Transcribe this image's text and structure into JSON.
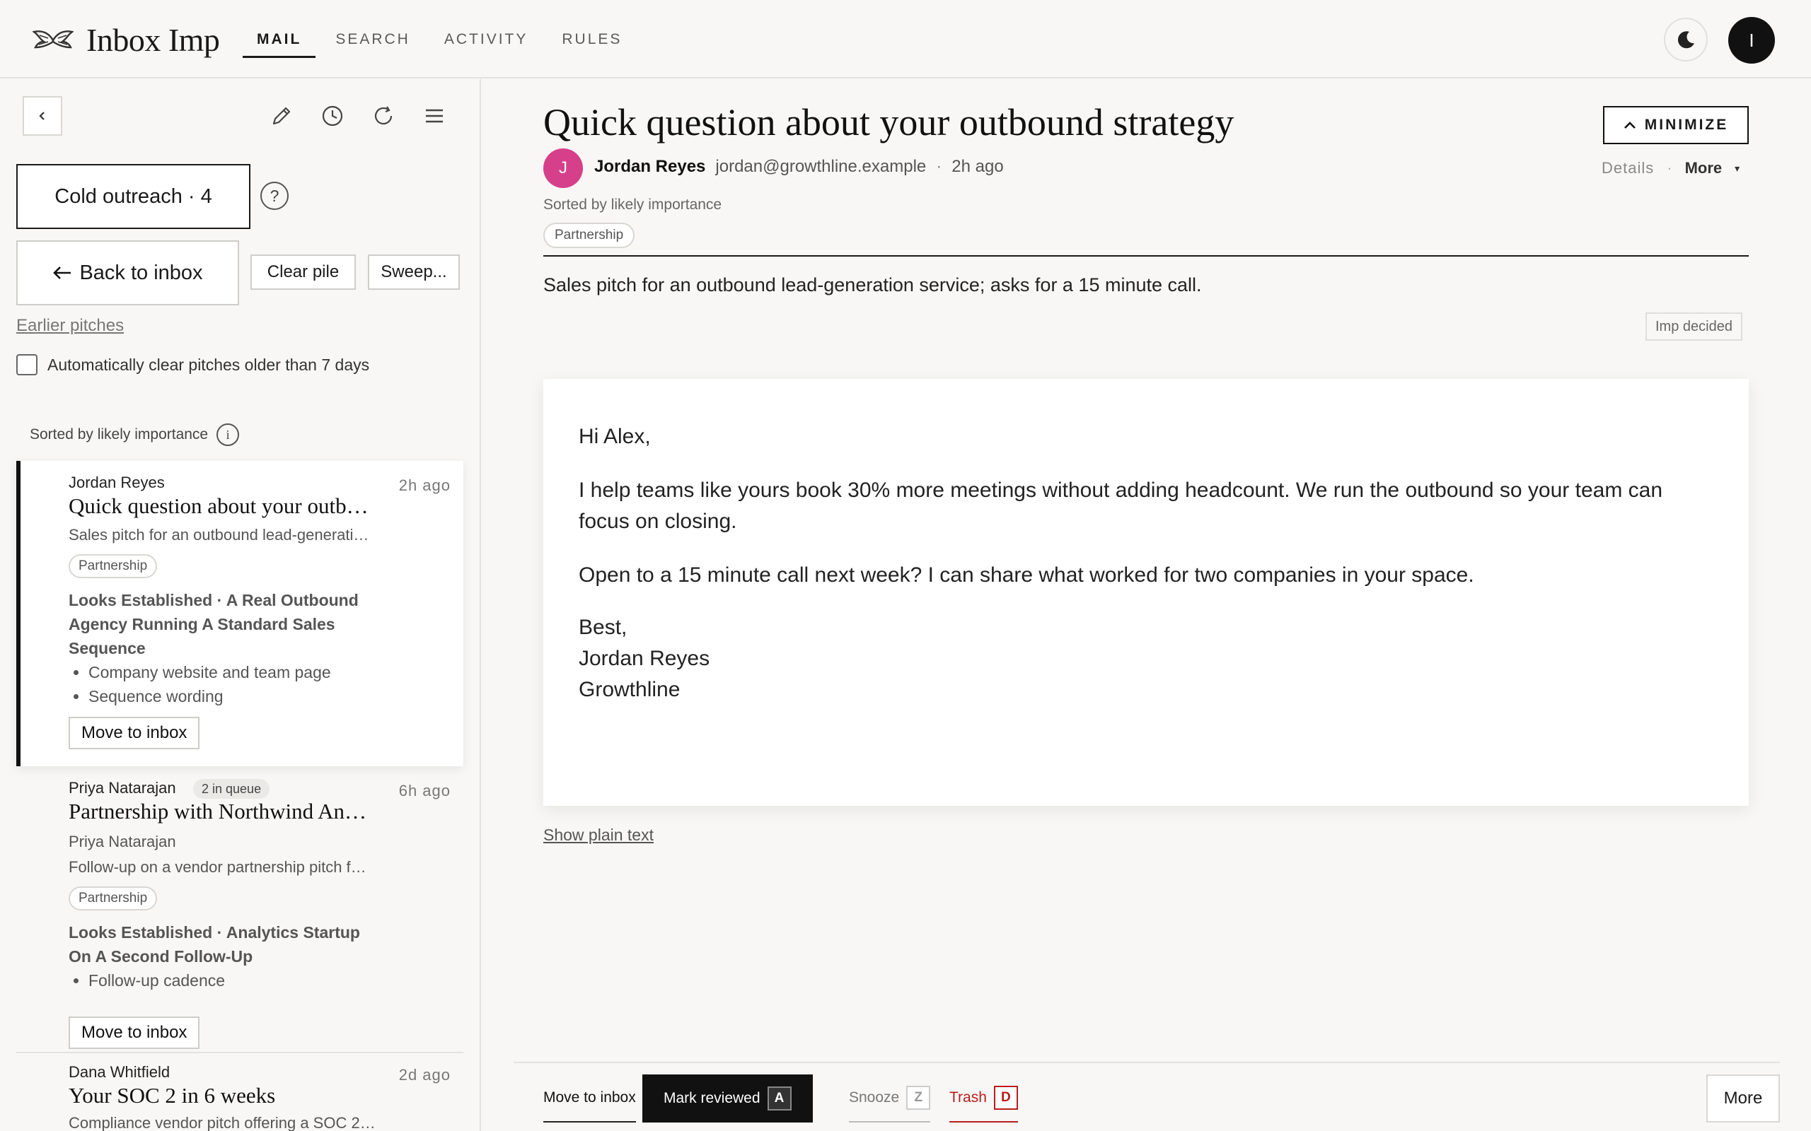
{
  "app": {
    "name": "Inbox Imp"
  },
  "nav": [
    {
      "label": "MAIL",
      "active": true
    },
    {
      "label": "SEARCH",
      "active": false
    },
    {
      "label": "ACTIVITY",
      "active": false
    },
    {
      "label": "RULES",
      "active": false
    }
  ],
  "user": {
    "initial": "I"
  },
  "sidebar": {
    "pile_label": "Cold outreach · 4",
    "help_glyph": "?",
    "back_label": "Back to inbox",
    "clear_label": "Clear pile",
    "sweep_label": "Sweep...",
    "earlier_label": "Earlier pitches",
    "auto_clear_label": "Automatically clear pitches older than 7 days",
    "auto_clear_checked": false,
    "sorted_label": "Sorted by likely importance",
    "info_glyph": "i",
    "cards": [
      {
        "sender": "Jordan Reyes",
        "time": "2h  ago",
        "subject": "Quick question about your outb…",
        "snippet": "Sales pitch for an outbound lead-generati…",
        "tag": "Partnership",
        "verdict": "Looks Established · A Real Outbound Agency Running A Standard Sales Sequence",
        "reasons": [
          "Company website and team page",
          "Sequence wording"
        ],
        "move_label": "Move to inbox"
      },
      {
        "sender": "Priya Natarajan",
        "queue_badge": "2 in queue",
        "time": "6h  ago",
        "subject": "Partnership with Northwind An…",
        "from_line": "Priya Natarajan",
        "snippet": "Follow-up on a vendor partnership pitch f…",
        "tag": "Partnership",
        "verdict": "Looks Established · Analytics Startup On A Second Follow-Up",
        "reasons": [
          "Follow-up cadence"
        ],
        "move_label": "Move to inbox"
      },
      {
        "sender": "Dana Whitfield",
        "time": "2d  ago",
        "subject": "Your SOC 2 in 6 weeks",
        "snippet": "Compliance vendor pitch offering a SOC 2…"
      }
    ]
  },
  "message": {
    "title": "Quick question about your outbound strategy",
    "minimize_label": "MINIMIZE",
    "sender_initial": "J",
    "sender_name": "Jordan Reyes",
    "sender_email": "jordan@growthline.example",
    "separator": "·",
    "time_ago": "2h ago",
    "details_label": "Details",
    "more_label": "More",
    "sorted_label": "Sorted by likely importance",
    "tag": "Partnership",
    "summary": "Sales pitch for an outbound lead-generation service; asks for a 15 minute call.",
    "imp_badge": "Imp decided",
    "body": {
      "greeting": "Hi Alex,",
      "para1": "I help teams like yours book 30% more meetings without adding headcount. We run the outbound so your team can focus on closing.",
      "para2": "Open to a 15 minute call next week? I can share what worked for two companies in your space.",
      "signoff": "Best,",
      "sig_name": "Jordan Reyes",
      "sig_company": "Growthline"
    },
    "plain_text_label": "Show plain text"
  },
  "actions": {
    "move_to_inbox": "Move to inbox",
    "mark_reviewed": "Mark reviewed",
    "mark_reviewed_key": "A",
    "snooze": "Snooze",
    "snooze_key": "Z",
    "trash": "Trash",
    "trash_key": "D",
    "more": "More"
  },
  "colors": {
    "accent": "#111111",
    "sender_avatar": "#d6408a",
    "trash": "#b91c1c"
  }
}
